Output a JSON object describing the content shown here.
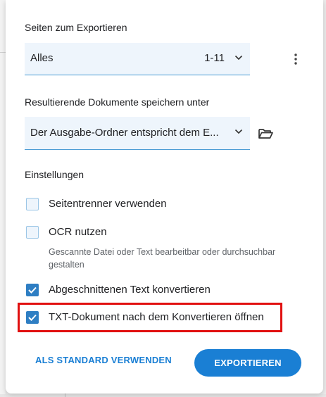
{
  "pages_section": {
    "label": "Seiten zum Exportieren",
    "selected": "Alles",
    "range": "1-11",
    "icon_chevron": "chevron-down-icon",
    "icon_more": "more-vert-icon"
  },
  "save_section": {
    "label": "Resultierende Dokumente speichern unter",
    "selected": "Der Ausgabe-Ordner entspricht dem E...",
    "icon_chevron": "chevron-down-icon",
    "icon_folder": "folder-open-icon"
  },
  "settings": {
    "label": "Einstellungen",
    "options": [
      {
        "label": "Seitentrenner verwenden",
        "checked": false
      },
      {
        "label": "OCR nutzen",
        "checked": false,
        "hint": "Gescannte Datei oder Text bearbeitbar oder durchsuchbar gestalten"
      },
      {
        "label": "Abgeschnittenen Text konvertieren",
        "checked": true
      },
      {
        "label": "TXT-Dokument nach dem Konvertieren öffnen",
        "checked": true
      }
    ]
  },
  "footer": {
    "default_button": "ALS STANDARD VERWENDEN",
    "export_button": "EXPORTIEREN"
  },
  "colors": {
    "accent": "#1a7fd4",
    "checkbox_checked": "#2e7ec3",
    "field_background": "#eef5fc",
    "highlight": "#e11010"
  }
}
